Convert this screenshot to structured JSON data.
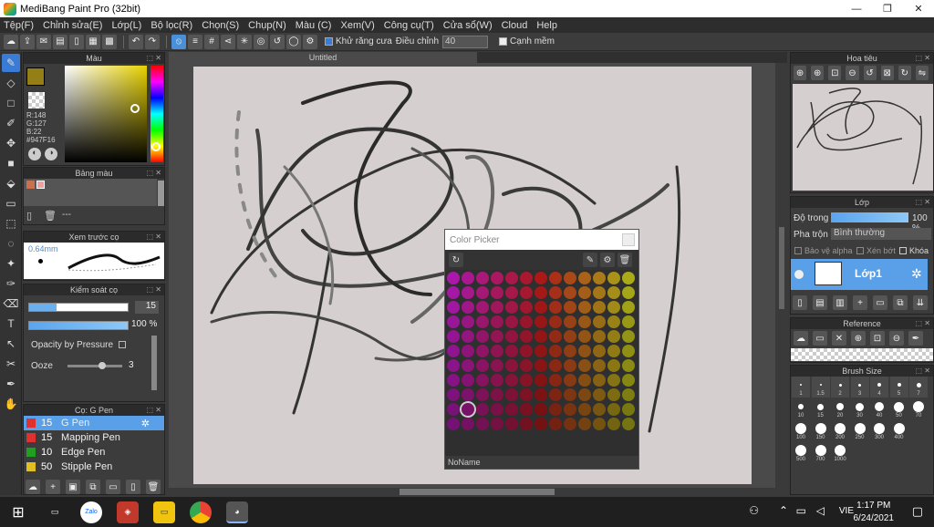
{
  "window": {
    "title": "MediBang Paint Pro (32bit)",
    "min": "—",
    "max": "❐",
    "close": "✕"
  },
  "menu": [
    "Tệp(F)",
    "Chỉnh sửa(E)",
    "Lớp(L)",
    "Bộ lọc(R)",
    "Chọn(S)",
    "Chụp(N)",
    "Màu (C)",
    "Xem(V)",
    "Công cụ(T)",
    "Cửa sổ(W)",
    "Cloud",
    "Help"
  ],
  "toolbar": {
    "antialias_label": "Khử răng cưa",
    "adjust_label": "Điều chỉnh",
    "adjust_value": "40",
    "edge_label": "Cạnh mềm"
  },
  "color_panel": {
    "title": "Màu",
    "r": "R:148",
    "g": "G:127",
    "b": "B:22",
    "hex": "#947F16",
    "primary": "#947F16"
  },
  "palette_panel": {
    "title": "Bảng màu",
    "more": "---"
  },
  "brush_preview": {
    "title": "Xem trước cọ",
    "size": "0.64mm"
  },
  "brush_control": {
    "title": "Kiểm soát cọ",
    "size_value": "15",
    "opacity_value": "100 %",
    "opacity_pressure": "Opacity by Pressure",
    "ooze_label": "Ooze",
    "ooze_value": "3"
  },
  "brush_list": {
    "title": "Cọ: G Pen",
    "items": [
      {
        "size": "15",
        "name": "G Pen",
        "color": "#e03030"
      },
      {
        "size": "15",
        "name": "Mapping Pen",
        "color": "#e03030"
      },
      {
        "size": "10",
        "name": "Edge Pen",
        "color": "#20a020"
      },
      {
        "size": "50",
        "name": "Stipple Pen",
        "color": "#e0c020"
      }
    ]
  },
  "canvas": {
    "tab": "Untitled"
  },
  "color_picker": {
    "title": "Color Picker",
    "footer": "NoName"
  },
  "navigator": {
    "title": "Hoa tiêu"
  },
  "layer_panel": {
    "title": "Lớp",
    "opacity_label": "Độ trong",
    "opacity_value": "100 %",
    "blend_label": "Pha trộn",
    "blend_value": "Bình thường",
    "protect_alpha": "Bảo vệ alpha",
    "clip": "Xén bớt",
    "lock": "Khóa",
    "layer_name": "Lớp1"
  },
  "reference": {
    "title": "Reference"
  },
  "brush_size": {
    "title": "Brush Size",
    "row1": [
      "1",
      "1.5",
      "2",
      "3",
      "4",
      "5",
      "7"
    ],
    "row2": [
      "10",
      "15",
      "20",
      "30",
      "40",
      "50",
      "70"
    ],
    "row3": [
      "100",
      "150",
      "200",
      "250",
      "300",
      "400"
    ],
    "row4": [
      "500",
      "700",
      "1000"
    ]
  },
  "taskbar": {
    "lang": "VIE",
    "time": "1:17 PM",
    "date": "6/24/2021",
    "zalo": "Zalo"
  }
}
